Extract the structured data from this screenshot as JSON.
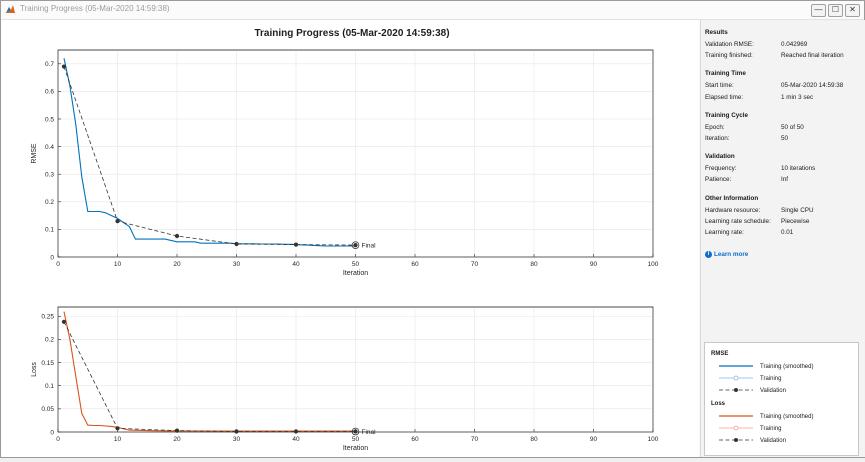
{
  "window": {
    "title": "Training Progress (05-Mar-2020 14:59:38)",
    "buttons": [
      "—",
      "☐",
      "✕"
    ]
  },
  "plot_title": "Training Progress (05-Mar-2020 14:59:38)",
  "chart_data": [
    {
      "type": "line",
      "ylabel": "RMSE",
      "xlabel": "Iteration",
      "xlim": [
        0,
        100
      ],
      "ylim": [
        0,
        0.75
      ],
      "xticks": [
        0,
        10,
        20,
        30,
        40,
        50,
        60,
        70,
        80,
        90,
        100
      ],
      "yticks": [
        0,
        0.1,
        0.2,
        0.3,
        0.4,
        0.5,
        0.6,
        0.7
      ],
      "grid": true,
      "series": [
        {
          "name": "Training (smoothed)",
          "color": "#0072bd",
          "x": [
            1,
            2,
            3,
            4,
            5,
            6,
            7,
            8,
            9,
            10,
            11,
            12,
            13,
            14,
            15,
            16,
            17,
            18,
            19,
            20,
            21,
            22,
            23,
            24,
            25,
            26,
            27,
            28,
            29,
            30,
            31,
            32,
            33,
            34,
            35,
            36,
            37,
            38,
            39,
            40,
            41,
            42,
            43,
            44,
            45,
            46,
            47,
            48,
            49,
            50
          ],
          "y": [
            0.72,
            0.62,
            0.48,
            0.29,
            0.165,
            0.165,
            0.165,
            0.16,
            0.15,
            0.14,
            0.125,
            0.11,
            0.065,
            0.065,
            0.065,
            0.065,
            0.065,
            0.065,
            0.06,
            0.055,
            0.055,
            0.055,
            0.055,
            0.05,
            0.05,
            0.05,
            0.05,
            0.05,
            0.05,
            0.048,
            0.048,
            0.048,
            0.048,
            0.047,
            0.047,
            0.047,
            0.047,
            0.046,
            0.046,
            0.045,
            0.044,
            0.043,
            0.042,
            0.041,
            0.04,
            0.04,
            0.04,
            0.04,
            0.04,
            0.04
          ]
        },
        {
          "name": "Validation",
          "color": "#000000",
          "x": [
            1,
            10,
            20,
            30,
            40,
            50
          ],
          "y": [
            0.69,
            0.13,
            0.076,
            0.047,
            0.045,
            0.043
          ]
        }
      ],
      "annotations": [
        {
          "text": "Final",
          "x": 50,
          "y": 0.043
        }
      ]
    },
    {
      "type": "line",
      "ylabel": "Loss",
      "xlabel": "Iteration",
      "xlim": [
        0,
        100
      ],
      "ylim": [
        0,
        0.27
      ],
      "xticks": [
        0,
        10,
        20,
        30,
        40,
        50,
        60,
        70,
        80,
        90,
        100
      ],
      "yticks": [
        0,
        0.05,
        0.1,
        0.15,
        0.2,
        0.25
      ],
      "grid": true,
      "series": [
        {
          "name": "Training (smoothed)",
          "color": "#d95319",
          "x": [
            1,
            2,
            3,
            4,
            5,
            6,
            7,
            8,
            9,
            10,
            12,
            15,
            20,
            25,
            30,
            35,
            40,
            45,
            50
          ],
          "y": [
            0.26,
            0.2,
            0.12,
            0.04,
            0.015,
            0.014,
            0.014,
            0.013,
            0.012,
            0.01,
            0.004,
            0.003,
            0.002,
            0.002,
            0.002,
            0.002,
            0.002,
            0.002,
            0.002
          ]
        },
        {
          "name": "Validation",
          "color": "#000000",
          "x": [
            1,
            10,
            20,
            30,
            40,
            50
          ],
          "y": [
            0.238,
            0.008,
            0.003,
            0.001,
            0.001,
            0.001
          ]
        }
      ],
      "annotations": [
        {
          "text": "Final",
          "x": 50,
          "y": 0.001
        }
      ]
    }
  ],
  "panel": {
    "results": {
      "header": "Results",
      "rows": [
        {
          "k": "Validation RMSE:",
          "v": "0.042969"
        },
        {
          "k": "Training finished:",
          "v": "Reached final iteration"
        }
      ]
    },
    "time": {
      "header": "Training Time",
      "rows": [
        {
          "k": "Start time:",
          "v": "05-Mar-2020 14:59:38"
        },
        {
          "k": "Elapsed time:",
          "v": "1 min 3 sec"
        }
      ]
    },
    "cycle": {
      "header": "Training Cycle",
      "rows": [
        {
          "k": "Epoch:",
          "v": "50 of 50"
        },
        {
          "k": "Iteration:",
          "v": "50"
        }
      ]
    },
    "validation": {
      "header": "Validation",
      "rows": [
        {
          "k": "Frequency:",
          "v": "10 iterations"
        },
        {
          "k": "Patience:",
          "v": "Inf"
        }
      ]
    },
    "other": {
      "header": "Other Information",
      "rows": [
        {
          "k": "Hardware resource:",
          "v": "Single CPU"
        },
        {
          "k": "Learning rate schedule:",
          "v": "Piecewise"
        },
        {
          "k": "Learning rate:",
          "v": "0.01"
        }
      ]
    },
    "learn_more": "Learn more"
  },
  "legend": {
    "rmse": {
      "title": "RMSE",
      "items": [
        "Training (smoothed)",
        "Training",
        "Validation"
      ],
      "colors": [
        "#0072bd",
        "#86b5df",
        "#333333"
      ]
    },
    "loss": {
      "title": "Loss",
      "items": [
        "Training (smoothed)",
        "Training",
        "Validation"
      ],
      "colors": [
        "#d95319",
        "#efa07f",
        "#333333"
      ]
    }
  }
}
